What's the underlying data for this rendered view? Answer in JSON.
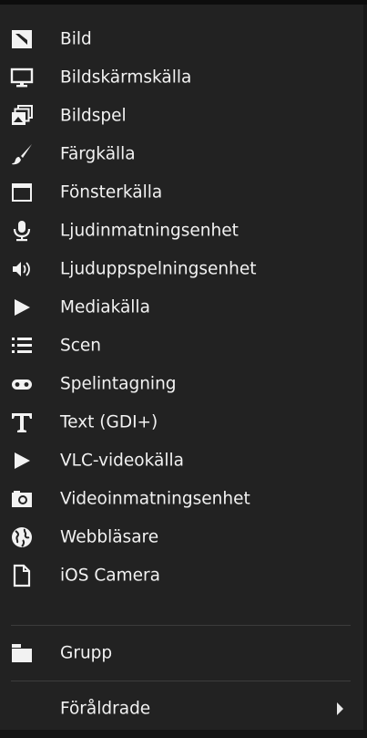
{
  "menu": {
    "items": [
      {
        "label": "Bild",
        "icon": "image-icon"
      },
      {
        "label": "Bildskärmskälla",
        "icon": "monitor-icon"
      },
      {
        "label": "Bildspel",
        "icon": "slideshow-icon"
      },
      {
        "label": "Färgkälla",
        "icon": "brush-icon"
      },
      {
        "label": "Fönsterkälla",
        "icon": "window-icon"
      },
      {
        "label": "Ljudinmatningsenhet",
        "icon": "microphone-icon"
      },
      {
        "label": "Ljuduppspelningsenhet",
        "icon": "speaker-icon"
      },
      {
        "label": "Mediakälla",
        "icon": "play-icon"
      },
      {
        "label": "Scen",
        "icon": "list-icon"
      },
      {
        "label": "Spelintagning",
        "icon": "gamepad-icon"
      },
      {
        "label": "Text (GDI+)",
        "icon": "text-icon"
      },
      {
        "label": "VLC-videokälla",
        "icon": "play-icon"
      },
      {
        "label": "Videoinmatningsenhet",
        "icon": "camera-icon"
      },
      {
        "label": "Webbläsare",
        "icon": "globe-icon"
      },
      {
        "label": "iOS Camera",
        "icon": "file-icon"
      }
    ],
    "group_item": {
      "label": "Grupp",
      "icon": "folder-icon"
    },
    "deprecated_item": {
      "label": "Föråldrade",
      "icon": "chevron-right-icon"
    }
  },
  "colors": {
    "background": "#222222",
    "text": "#f2f2f2",
    "separator": "#3c3c3c"
  }
}
